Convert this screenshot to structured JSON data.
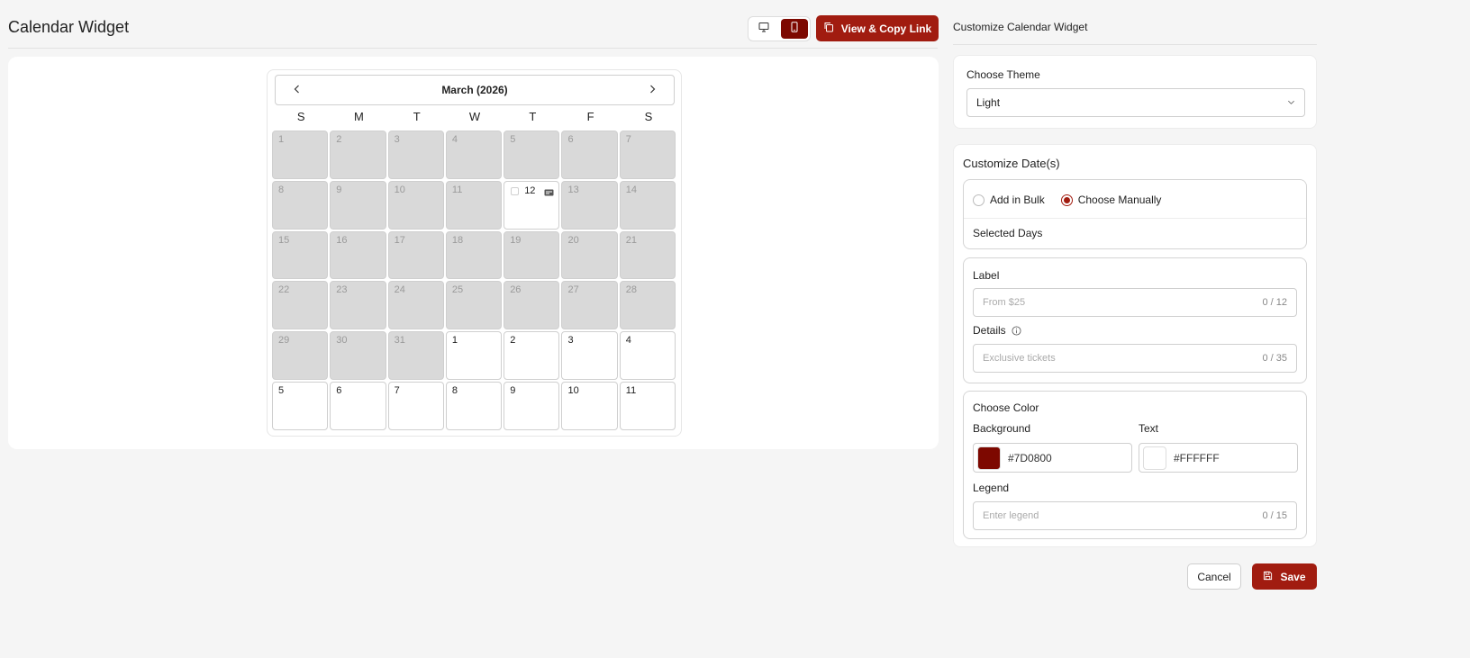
{
  "header": {
    "title": "Calendar Widget",
    "view_toggle": {
      "desktop_icon": "desktop-icon",
      "mobile_icon": "mobile-icon",
      "active": "mobile"
    },
    "copy_link_label": "View & Copy Link"
  },
  "calendar": {
    "month_label": "March (2026)",
    "weekdays": [
      "S",
      "M",
      "T",
      "W",
      "T",
      "F",
      "S"
    ],
    "rows": [
      [
        {
          "n": "1",
          "s": "outside"
        },
        {
          "n": "2",
          "s": "outside"
        },
        {
          "n": "3",
          "s": "outside"
        },
        {
          "n": "4",
          "s": "outside"
        },
        {
          "n": "5",
          "s": "outside"
        },
        {
          "n": "6",
          "s": "outside"
        },
        {
          "n": "7",
          "s": "outside"
        }
      ],
      [
        {
          "n": "8",
          "s": "outside"
        },
        {
          "n": "9",
          "s": "outside"
        },
        {
          "n": "10",
          "s": "outside"
        },
        {
          "n": "11",
          "s": "outside"
        },
        {
          "n": "12",
          "s": "selected"
        },
        {
          "n": "13",
          "s": "outside"
        },
        {
          "n": "14",
          "s": "outside"
        }
      ],
      [
        {
          "n": "15",
          "s": "outside"
        },
        {
          "n": "16",
          "s": "outside"
        },
        {
          "n": "17",
          "s": "outside"
        },
        {
          "n": "18",
          "s": "outside"
        },
        {
          "n": "19",
          "s": "outside"
        },
        {
          "n": "20",
          "s": "outside"
        },
        {
          "n": "21",
          "s": "outside"
        }
      ],
      [
        {
          "n": "22",
          "s": "outside"
        },
        {
          "n": "23",
          "s": "outside"
        },
        {
          "n": "24",
          "s": "outside"
        },
        {
          "n": "25",
          "s": "outside"
        },
        {
          "n": "26",
          "s": "outside"
        },
        {
          "n": "27",
          "s": "outside"
        },
        {
          "n": "28",
          "s": "outside"
        }
      ],
      [
        {
          "n": "29",
          "s": "outside"
        },
        {
          "n": "30",
          "s": "outside"
        },
        {
          "n": "31",
          "s": "outside"
        },
        {
          "n": "1",
          "s": "current"
        },
        {
          "n": "2",
          "s": "current"
        },
        {
          "n": "3",
          "s": "current"
        },
        {
          "n": "4",
          "s": "current"
        }
      ],
      [
        {
          "n": "5",
          "s": "current"
        },
        {
          "n": "6",
          "s": "current"
        },
        {
          "n": "7",
          "s": "current"
        },
        {
          "n": "8",
          "s": "current"
        },
        {
          "n": "9",
          "s": "current"
        },
        {
          "n": "10",
          "s": "current"
        },
        {
          "n": "11",
          "s": "current"
        }
      ]
    ]
  },
  "panel": {
    "title": "Customize Calendar Widget",
    "theme": {
      "label": "Choose Theme",
      "value": "Light"
    },
    "dates": {
      "title": "Customize Date(s)",
      "mode_bulk": "Add in Bulk",
      "mode_manual": "Choose Manually",
      "mode_selected": "manual",
      "selected_days_label": "Selected Days",
      "label_field": {
        "label": "Label",
        "placeholder": "From $25",
        "counter": "0 / 12"
      },
      "details_field": {
        "label": "Details",
        "placeholder": "Exclusive tickets",
        "counter": "0 / 35"
      },
      "color": {
        "title": "Choose Color",
        "background_label": "Background",
        "background_value": "#7D0800",
        "text_label": "Text",
        "text_value": "#FFFFFF"
      },
      "legend_field": {
        "label": "Legend",
        "placeholder": "Enter legend",
        "counter": "0 / 15"
      }
    }
  },
  "actions": {
    "cancel_label": "Cancel",
    "save_label": "Save"
  },
  "colors": {
    "accent": "#a11c10",
    "brand_dark": "#7d0800",
    "outside_day": "#d9d9d9"
  }
}
